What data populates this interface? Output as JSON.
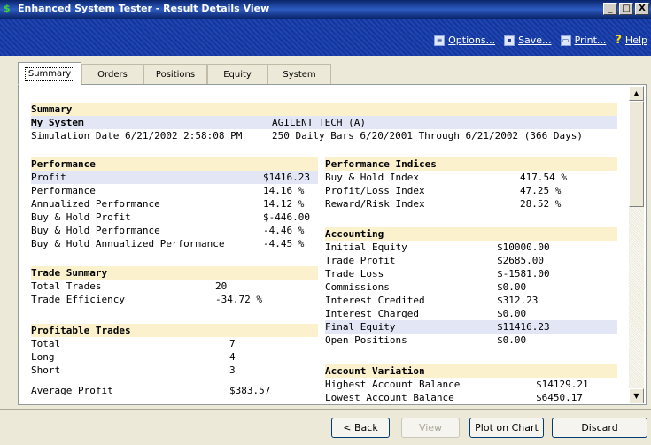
{
  "window": {
    "title": "Enhanced System Tester - Result Details View",
    "controls": [
      "_",
      "□",
      "X"
    ]
  },
  "toolbar": {
    "options": "Options...",
    "save": "Save...",
    "print": "Print...",
    "help": "Help"
  },
  "tabs": [
    "Summary",
    "Orders",
    "Positions",
    "Equity",
    "System"
  ],
  "summary": {
    "header": "Summary",
    "system_label": "My System",
    "symbol": "AGILENT TECH (A)",
    "sim_date": "Simulation Date 6/21/2002 2:58:08 PM",
    "bars": "250 Daily Bars 6/20/2001 Through 6/21/2002 (366 Days)"
  },
  "performance": {
    "header": "Performance",
    "rows": [
      {
        "label": "Profit",
        "value": "$1416.23"
      },
      {
        "label": "Performance",
        "value": "14.16 %"
      },
      {
        "label": "Annualized Performance",
        "value": "14.12 %"
      },
      {
        "label": "Buy & Hold Profit",
        "value": "$-446.00"
      },
      {
        "label": "Buy & Hold Performance",
        "value": "-4.46 %"
      },
      {
        "label": "Buy & Hold Annualized Performance",
        "value": "-4.45 %"
      }
    ]
  },
  "trade_summary": {
    "header": "Trade Summary",
    "rows": [
      {
        "label": "Total Trades",
        "value": "20"
      },
      {
        "label": "Trade Efficiency",
        "value": "-34.72 %"
      }
    ]
  },
  "profitable_trades": {
    "header": "Profitable Trades",
    "rows": [
      {
        "label": "Total",
        "value": "7"
      },
      {
        "label": "Long",
        "value": "4"
      },
      {
        "label": "Short",
        "value": "3"
      },
      {
        "label": "Average Profit",
        "value": "$383.57"
      }
    ]
  },
  "performance_indices": {
    "header": "Performance Indices",
    "rows": [
      {
        "label": "Buy & Hold Index",
        "value": "417.54 %"
      },
      {
        "label": "Profit/Loss Index",
        "value": "47.25 %"
      },
      {
        "label": "Reward/Risk Index",
        "value": "28.52 %"
      }
    ]
  },
  "accounting": {
    "header": "Accounting",
    "rows": [
      {
        "label": "Initial Equity",
        "value": "$10000.00"
      },
      {
        "label": "Trade Profit",
        "value": "$2685.00"
      },
      {
        "label": "Trade Loss",
        "value": "$-1581.00"
      },
      {
        "label": "Commissions",
        "value": "$0.00"
      },
      {
        "label": "Interest Credited",
        "value": "$312.23"
      },
      {
        "label": "Interest Charged",
        "value": "$0.00"
      },
      {
        "label": "Final Equity",
        "value": "$11416.23"
      },
      {
        "label": "Open Positions",
        "value": "$0.00"
      }
    ]
  },
  "account_variation": {
    "header": "Account Variation",
    "rows": [
      {
        "label": "Highest Account Balance",
        "value": "$14129.21"
      },
      {
        "label": "Lowest Account Balance",
        "value": "$6450.17"
      }
    ]
  },
  "buttons": {
    "back": "< Back",
    "view": "View",
    "plot": "Plot on Chart",
    "discard": "Discard"
  },
  "colors": {
    "section_header_bg": "#fbf1cc",
    "highlight_row_bg": "#e3e6f5",
    "title_bar": "#0a246a"
  }
}
